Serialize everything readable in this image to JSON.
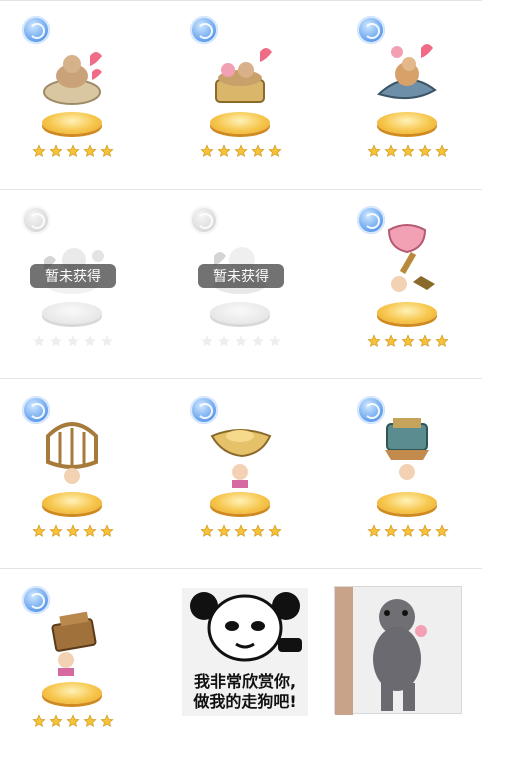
{
  "items": [
    {
      "name": "cat-basket-trophy",
      "unlocked": true,
      "stars": 5
    },
    {
      "name": "cat-tub-trophy",
      "unlocked": true,
      "stars": 5
    },
    {
      "name": "cat-shark-trophy",
      "unlocked": true,
      "stars": 5
    },
    {
      "name": "cat-trophy-locked-1",
      "unlocked": false,
      "stars": 5
    },
    {
      "name": "cat-trophy-locked-2",
      "unlocked": false,
      "stars": 5
    },
    {
      "name": "goblet-trophy",
      "unlocked": true,
      "stars": 5
    },
    {
      "name": "cage-trophy",
      "unlocked": true,
      "stars": 5
    },
    {
      "name": "gold-ingot-trophy",
      "unlocked": true,
      "stars": 5
    },
    {
      "name": "jade-seal-trophy",
      "unlocked": true,
      "stars": 5
    },
    {
      "name": "treasure-chest-trophy",
      "unlocked": true,
      "stars": 5
    }
  ],
  "locked_label": "暂未获得",
  "memes": {
    "panda_text_line1": "我非常欣赏你,",
    "panda_text_line2": "做我的走狗吧!"
  },
  "colors": {
    "star": "#f6c23a",
    "badge": "#4f8fe6",
    "pedestal": "#f6c64c"
  }
}
